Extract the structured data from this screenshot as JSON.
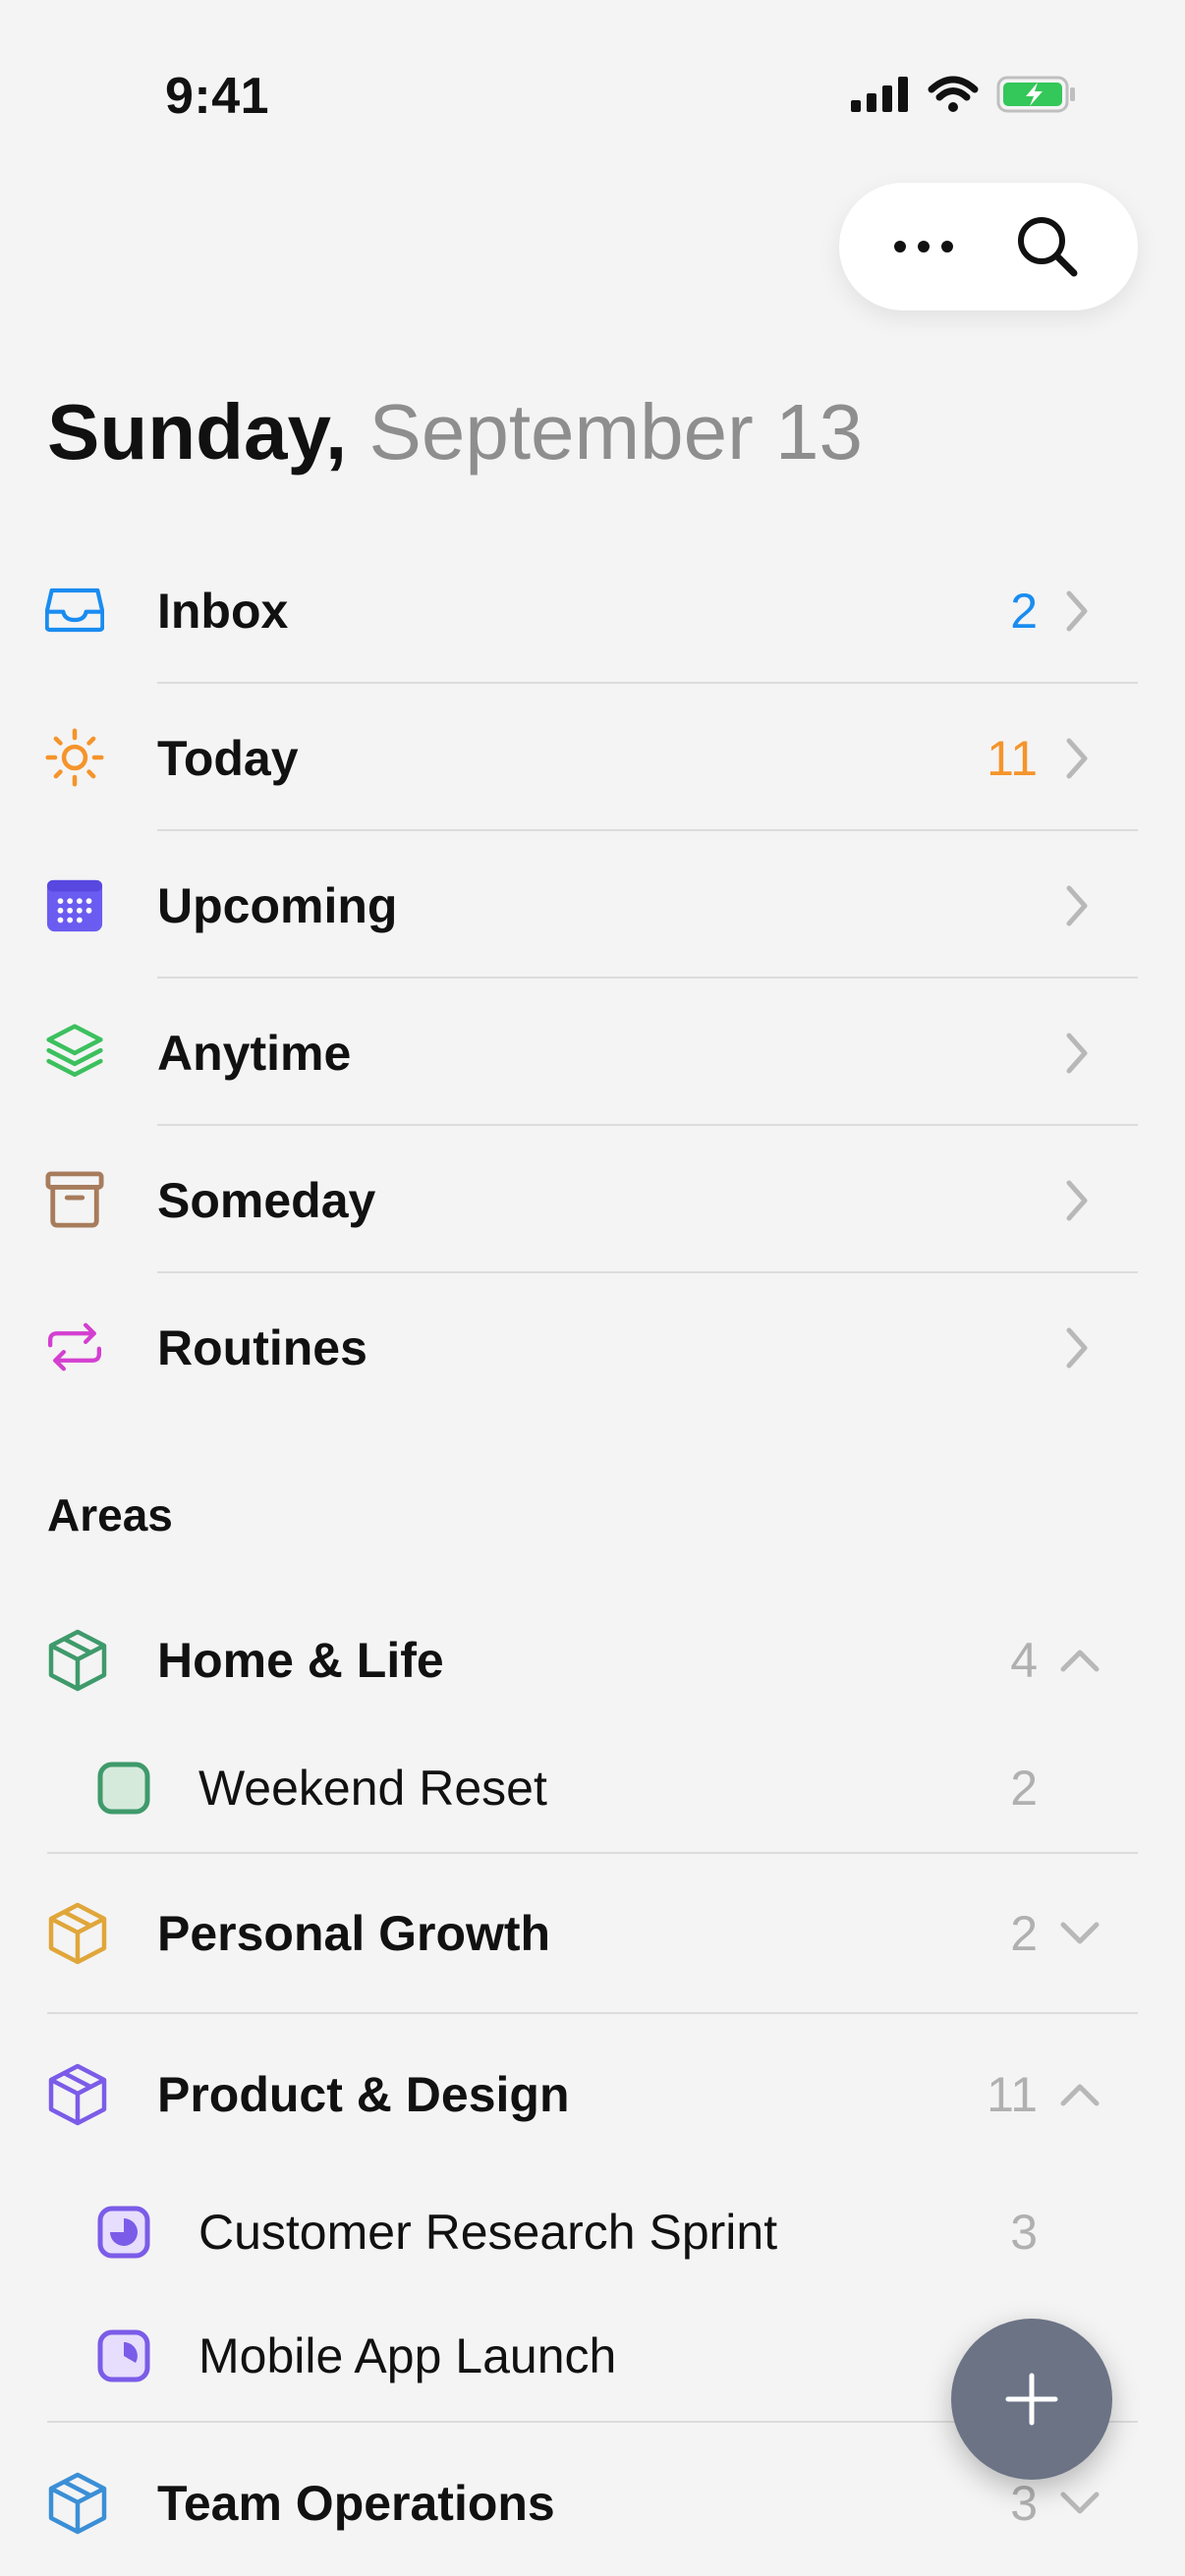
{
  "status_bar": {
    "time": "9:41"
  },
  "header": {
    "day": "Sunday,",
    "date": "September 13"
  },
  "nav": [
    {
      "label": "Inbox",
      "count": "2",
      "count_color": "#1a8cf0",
      "icon": "inbox-icon"
    },
    {
      "label": "Today",
      "count": "11",
      "count_color": "#f5942b",
      "icon": "sun-icon"
    },
    {
      "label": "Upcoming",
      "count": "",
      "icon": "calendar-icon"
    },
    {
      "label": "Anytime",
      "count": "",
      "icon": "layers-icon"
    },
    {
      "label": "Someday",
      "count": "",
      "icon": "archive-box-icon"
    },
    {
      "label": "Routines",
      "count": "",
      "icon": "repeat-icon"
    }
  ],
  "areas_title": "Areas",
  "areas": [
    {
      "label": "Home & Life",
      "count": "4",
      "color": "#3f9a6b",
      "expanded": true,
      "projects": [
        {
          "label": "Weekend Reset",
          "count": "2"
        }
      ]
    },
    {
      "label": "Personal Growth",
      "count": "2",
      "color": "#e0a63a",
      "expanded": false,
      "projects": []
    },
    {
      "label": "Product & Design",
      "count": "11",
      "color": "#7b5ce8",
      "expanded": true,
      "projects": [
        {
          "label": "Customer Research Sprint",
          "count": "3"
        },
        {
          "label": "Mobile App Launch",
          "count": ""
        }
      ]
    },
    {
      "label": "Team Operations",
      "count": "3",
      "color": "#3b8fd6",
      "expanded": false,
      "projects": []
    }
  ]
}
